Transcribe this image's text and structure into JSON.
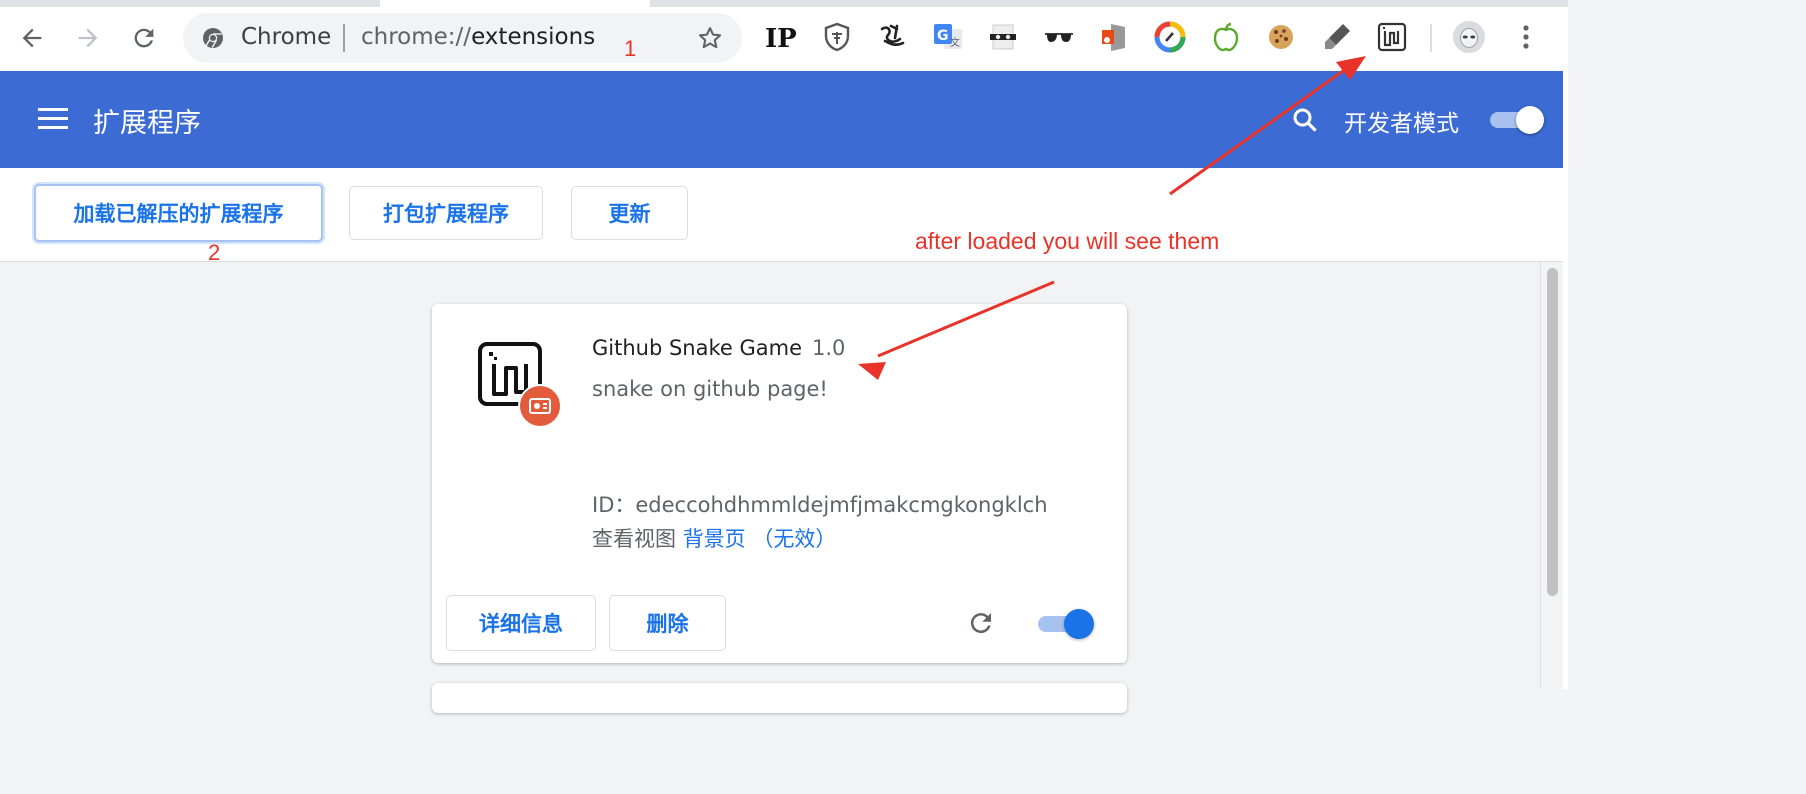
{
  "browser": {
    "omnibox": {
      "site_label": "Chrome",
      "url_scheme": "chrome://",
      "url_path": "extensions"
    },
    "extension_icons": [
      "ip-icon",
      "shield-icon",
      "calligraphy-icon",
      "google-translate-icon",
      "mask-icon",
      "sunglasses-icon",
      "office-icon",
      "compass-icon",
      "apple-icon",
      "cookie-icon",
      "highlighter-icon",
      "snake-game-icon"
    ]
  },
  "header": {
    "title": "扩展程序",
    "dev_mode_label": "开发者模式",
    "dev_mode_on": true,
    "accent_color": "#3c6bd4"
  },
  "actions": {
    "load_unpacked": "加载已解压的扩展程序",
    "pack": "打包扩展程序",
    "update": "更新"
  },
  "extension": {
    "name": "Github Snake Game",
    "version": "1.0",
    "description": "snake on github page!",
    "id_text": "ID：edeccohdhmmldejmfjmakcmgkongklch",
    "views_label": "查看视图",
    "views_link": "背景页 （无效）",
    "details_button": "详细信息",
    "remove_button": "删除",
    "enabled": true
  },
  "annotations": {
    "step1": "1",
    "step2": "2",
    "note": "after loaded you will see them",
    "color": "#e8332a"
  }
}
